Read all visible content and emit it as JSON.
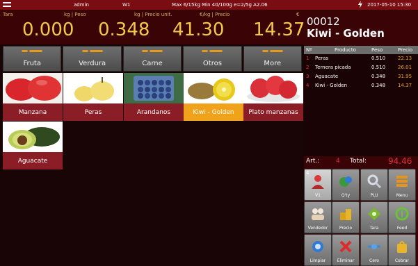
{
  "status": {
    "left": "admin",
    "scale": "W1",
    "info": "Max 6/15kg Min 40/100g e=2/5g A2.06",
    "datetime": "2017-05-10 15:30"
  },
  "display": {
    "tara_label": "Tara",
    "peso_label": "kg | Peso",
    "precio_unit_label": "kg | Precio unit.",
    "precio_label": "€/kg | Precio",
    "currency": "€",
    "tara": "0.000",
    "peso": "0.348",
    "precio_unit": "41.30",
    "precio": "14.37"
  },
  "categories": [
    "Fruta",
    "Verdura",
    "Carne",
    "Otros",
    "More"
  ],
  "products": [
    {
      "label": "Manzana",
      "selected": false
    },
    {
      "label": "Peras",
      "selected": false
    },
    {
      "label": "Arandanos",
      "selected": false
    },
    {
      "label": "Kiwi - Golden",
      "selected": true
    },
    {
      "label": "Plato manzanas",
      "selected": false
    },
    {
      "label": "Aguacate",
      "selected": false
    }
  ],
  "current": {
    "code": "00012",
    "name": "Kiwi - Golden"
  },
  "cart": {
    "headers": [
      "Nº",
      "Producto",
      "Peso",
      "Precio"
    ],
    "rows": [
      {
        "n": "1",
        "name": "Peras",
        "peso": "0.510",
        "precio": "22.13"
      },
      {
        "n": "2",
        "name": "Ternera picada",
        "peso": "0.510",
        "precio": "26.01"
      },
      {
        "n": "3",
        "name": "Aguacate",
        "peso": "0.348",
        "precio": "31.95"
      },
      {
        "n": "4",
        "name": "Kiwi - Golden",
        "peso": "0.348",
        "precio": "14.37"
      }
    ]
  },
  "totals": {
    "art_label": "Art.:",
    "art": "4",
    "total_label": "Total:",
    "total": "94.46"
  },
  "functions": {
    "badge": "4",
    "keys": [
      "V1",
      "Q'ty",
      "PLU",
      "Menu",
      "Vendedor",
      "Precio",
      "Tara",
      "Feed",
      "Limpiar",
      "Eliminar",
      "Cero",
      "Cobrar"
    ]
  }
}
